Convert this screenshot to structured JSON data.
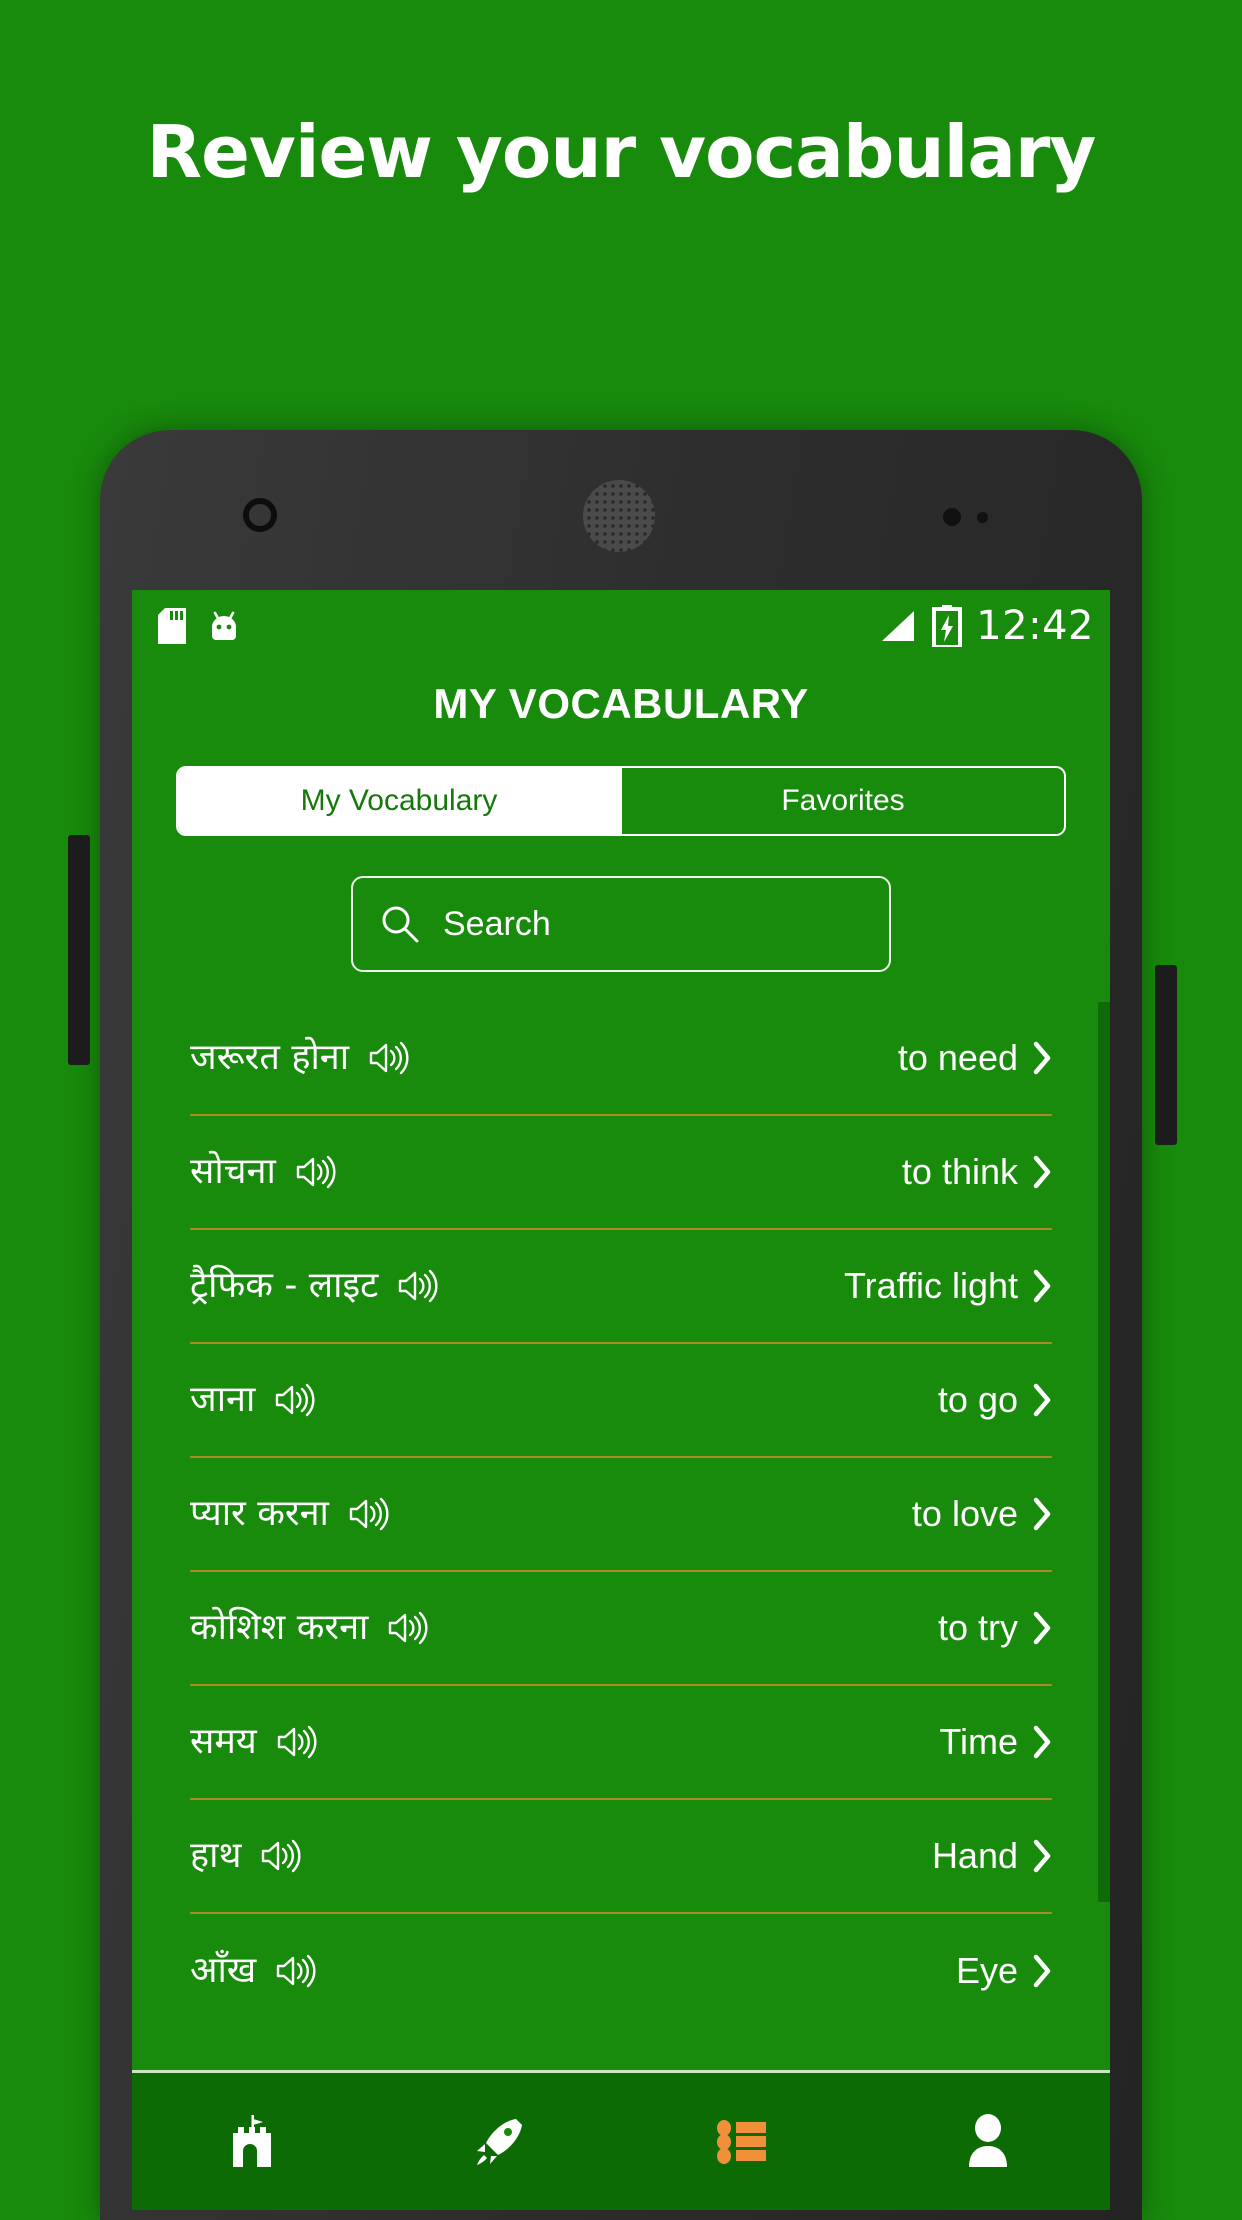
{
  "promo": {
    "headline": "Review your vocabulary",
    "background_color": "#188a0c"
  },
  "device": {
    "frame_color": "#2e2e2e",
    "camera_icon": "camera-lens-icon",
    "speaker_icon": "earpiece-speaker-icon",
    "volume_button": "volume-button",
    "power_button": "power-button"
  },
  "statusbar": {
    "sd_icon": "sd-card-icon",
    "android_icon": "android-robot-icon",
    "signal_icon": "signal-bars-icon",
    "battery_icon": "battery-charging-icon",
    "clock": "12:42"
  },
  "app": {
    "title": "MY VOCABULARY",
    "accent_green": "#188a0c",
    "divider_color": "#a98a23",
    "active_nav_color": "#f0913a"
  },
  "tabs": [
    {
      "label": "My Vocabulary",
      "active": true
    },
    {
      "label": "Favorites",
      "active": false
    }
  ],
  "search": {
    "placeholder": "Search",
    "value": "",
    "icon": "search-icon"
  },
  "vocabulary": {
    "speaker_icon": "speaker-audio-icon",
    "chevron_icon": "chevron-right-icon",
    "items": [
      {
        "word": "जरूरत होना",
        "translation": "to need"
      },
      {
        "word": "सोचना",
        "translation": "to think"
      },
      {
        "word": "ट्रैफिक - लाइट",
        "translation": "Traffic light"
      },
      {
        "word": "जाना",
        "translation": "to go"
      },
      {
        "word": "प्यार करना",
        "translation": "to love"
      },
      {
        "word": "कोशिश करना",
        "translation": "to try"
      },
      {
        "word": "समय",
        "translation": "Time"
      },
      {
        "word": "हाथ",
        "translation": "Hand"
      },
      {
        "word": "आँख",
        "translation": "Eye"
      }
    ]
  },
  "bottom_nav": [
    {
      "icon": "castle-icon",
      "active": false
    },
    {
      "icon": "rocket-icon",
      "active": false
    },
    {
      "icon": "list-icon",
      "active": true
    },
    {
      "icon": "person-icon",
      "active": false
    }
  ]
}
